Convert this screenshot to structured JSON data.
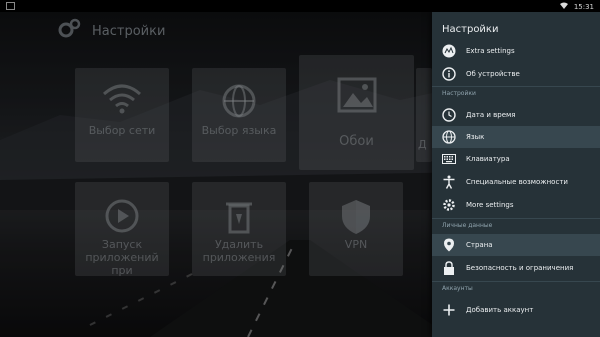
{
  "statusbar": {
    "time": "15:31"
  },
  "background": {
    "title": "Настройки",
    "tiles_row1": [
      {
        "label": "Выбор сети",
        "icon": "wifi-icon"
      },
      {
        "label": "Выбор языка",
        "icon": "globe-icon"
      },
      {
        "label": "Обои",
        "icon": "image-icon"
      },
      {
        "label": "Д",
        "icon": ""
      }
    ],
    "tiles_row2": [
      {
        "label": "Запуск приложений при",
        "icon": "play-icon"
      },
      {
        "label": "Удалить приложения",
        "icon": "trash-icon"
      },
      {
        "label": "VPN",
        "icon": "shield-icon"
      }
    ]
  },
  "panel": {
    "title": "Настройки",
    "top_items": [
      {
        "label": "Extra settings",
        "icon": "extra-settings-icon"
      },
      {
        "label": "Об устройстве",
        "icon": "info-icon"
      }
    ],
    "sections": [
      {
        "label": "Настройки",
        "items": [
          {
            "label": "Дата и время",
            "icon": "clock-icon"
          },
          {
            "label": "Язык",
            "icon": "globe-icon",
            "selected": true
          },
          {
            "label": "Клавиатура",
            "icon": "keyboard-icon"
          },
          {
            "label": "Специальные возможности",
            "icon": "accessibility-icon"
          },
          {
            "label": "More settings",
            "icon": "gear-icon"
          }
        ]
      },
      {
        "label": "Личные данные",
        "items": [
          {
            "label": "Страна",
            "icon": "location-icon",
            "selected": true
          },
          {
            "label": "Безопасность и ограничения",
            "icon": "lock-icon"
          }
        ]
      },
      {
        "label": "Аккаунты",
        "items": [
          {
            "label": "Добавить аккаунт",
            "icon": "plus-icon"
          }
        ]
      }
    ]
  },
  "colors": {
    "panel_bg": "#263238",
    "selected_bg": "#37474f",
    "section_label": "#90a4ae"
  }
}
